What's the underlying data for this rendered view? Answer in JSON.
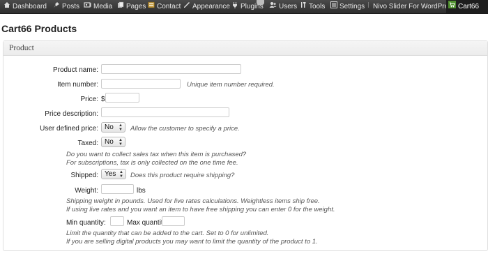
{
  "adminbar": {
    "items": [
      {
        "label": "Dashboard",
        "icon": "dashboard-icon"
      },
      {
        "label": "Posts",
        "icon": "pin-icon"
      },
      {
        "label": "Media",
        "icon": "media-icon"
      },
      {
        "label": "Pages",
        "icon": "pages-icon"
      },
      {
        "label": "Contact",
        "icon": "contact-icon"
      },
      {
        "label": "Appearance",
        "icon": "appearance-icon"
      },
      {
        "label": "Plugins",
        "icon": "plugins-icon"
      },
      {
        "label": "Users",
        "icon": "users-icon"
      },
      {
        "label": "Tools",
        "icon": "tools-icon"
      },
      {
        "label": "Settings",
        "icon": "settings-icon"
      },
      {
        "label": "Nivo Slider For WordPress",
        "icon": ""
      },
      {
        "label": "Cart66",
        "icon": "cart66-icon"
      }
    ]
  },
  "page": {
    "title": "Cart66 Products"
  },
  "product": {
    "heading": "Product",
    "name_label": "Product name:",
    "item_number_label": "Item number:",
    "item_number_note": "Unique item number required.",
    "price_label": "Price:",
    "currency": "$",
    "price_description_label": "Price description:",
    "user_defined_price_label": "User defined price:",
    "user_defined_price_value": "No",
    "user_defined_price_note": "Allow the customer to specify a price.",
    "taxed_label": "Taxed:",
    "taxed_value": "No",
    "taxed_note_1": "Do you want to collect sales tax when this item is purchased?",
    "taxed_note_2": "For subscriptions, tax is only collected on the one time fee.",
    "shipped_label": "Shipped:",
    "shipped_value": "Yes",
    "shipped_note": "Does this product require shipping?",
    "weight_label": "Weight:",
    "weight_unit": "lbs",
    "weight_note_1": "Shipping weight in pounds. Used for live rates calculations. Weightless items ship free.",
    "weight_note_2": "If using live rates and you want an item to have free shipping you can enter 0 for the weight.",
    "min_qty_label": "Min quantity:",
    "max_qty_label": "Max quantity:",
    "qty_note_1": "Limit the quantity that can be added to the cart. Set to 0 for unlimited.",
    "qty_note_2": "If you are selling digital products you may want to limit the quantity of the product to 1."
  },
  "colors": {
    "adminbar": "#3a3a3a",
    "active_tab": "#1e1e1e",
    "text": "#222222",
    "note": "#555555"
  }
}
